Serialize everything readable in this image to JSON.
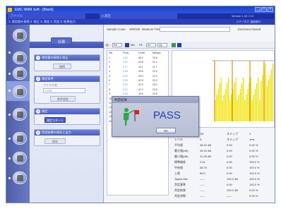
{
  "window": {
    "title": "EMC NMM Soft - [Blank]",
    "tab_left": "ファイル",
    "tab_right": "3 測定",
    "version": "Version 1.40 / 0.0",
    "subtitle": "1. 測定器を接続 2. 校正 3. 測定 4. 判定 5. 結果出力",
    "sub_right": "ステータス: 接続済み"
  },
  "steps": [
    {
      "num": "1",
      "title": "測定器の接続と校正",
      "button": "接続"
    },
    {
      "num": "2",
      "title": "測定条件",
      "label": "ファイル名",
      "select": "LIMIT",
      "button": "条件設定"
    },
    {
      "num": "3",
      "title": "測定",
      "button": "測定スタート"
    },
    {
      "num": "4",
      "title": "判定結果の保存と出力",
      "button": "保存"
    }
  ],
  "panel": {
    "head": "計測"
  },
  "main": {
    "sample_count_label": "Sample Count",
    "sample_count_value": "100/100",
    "measure_time_label": "Measure Time",
    "status_label": "Ext.Event Closed",
    "toolbar": [
      "Ext",
      "Mix",
      "Pk",
      "Av",
      "Qp"
    ]
  },
  "table": {
    "headers": [
      "No.",
      "Freq",
      "Level",
      "Margin"
    ],
    "rows": [
      [
        "1",
        "0.15",
        "45.2",
        "20.8"
      ],
      [
        "2",
        "0.16",
        "44.8",
        "21.1"
      ],
      [
        "3",
        "0.17",
        "44.1",
        "21.7"
      ],
      [
        "4",
        "0.18",
        "43.6",
        "22.0"
      ],
      [
        "5",
        "0.19",
        "43.0",
        "22.4"
      ],
      [
        "6",
        "0.20",
        "42.5",
        "22.9"
      ],
      [
        "7",
        "0.22",
        "41.9",
        "23.4"
      ],
      [
        "8",
        "0.24",
        "41.2",
        "24.0"
      ],
      [
        "9",
        "0.26",
        "40.6",
        "24.5"
      ],
      [
        "10",
        "0.28",
        "40.0",
        "25.0"
      ],
      [
        "11",
        "0.30",
        "39.3",
        "25.6"
      ],
      [
        "12",
        "0.33",
        "38.7",
        "26.1"
      ],
      [
        "13",
        "0.36",
        "38.1",
        "26.6"
      ],
      [
        "14",
        "0.39",
        "37.5",
        "27.1"
      ],
      [
        "15",
        "0.42",
        "36.9",
        "27.6"
      ]
    ]
  },
  "results": {
    "rows": [
      [
        "判定",
        "OK",
        "ステップ",
        "1"
      ],
      [
        "レベル",
        "A",
        "ステップ",
        "1ms"
      ],
      [
        "平均値",
        "38.92 dB",
        "0.00",
        "0.00 %"
      ],
      [
        "最大値(dB)",
        "45.20 dB",
        "0.00",
        "0.00 %"
      ],
      [
        "最小値(dB)",
        "31.05 dB",
        "0.00",
        "0.00 %"
      ],
      [
        "標準偏差",
        "2.51",
        "0.00",
        "100.0 %"
      ],
      [
        "中央値",
        "38.70",
        "0.00",
        "100.0 %"
      ],
      [
        "上限",
        "65.0",
        "0.00",
        "100.0 %"
      ],
      [
        "Sigma Min",
        "-----",
        "100.0 dB",
        "100.0 %"
      ],
      [
        "判定基準",
        "-----",
        "0.00",
        "100.0 %"
      ],
      [
        "判定結果",
        "-----",
        "100.0 dB",
        "0.00 %"
      ],
      [
        "判定状態",
        "-----",
        "-----",
        "0.00 %"
      ]
    ]
  },
  "dialog": {
    "title": "判定結果",
    "message": "PASS",
    "ok_label": "OK",
    "icon": "figure-with-flag-icon"
  },
  "colors": {
    "title_bar": "#1c3fc4",
    "accent_blue": "#2a3fc0",
    "pass_text": "#1f3fb8",
    "bars_yellow": "#f0e200",
    "limit_orange": "#e08a00"
  }
}
